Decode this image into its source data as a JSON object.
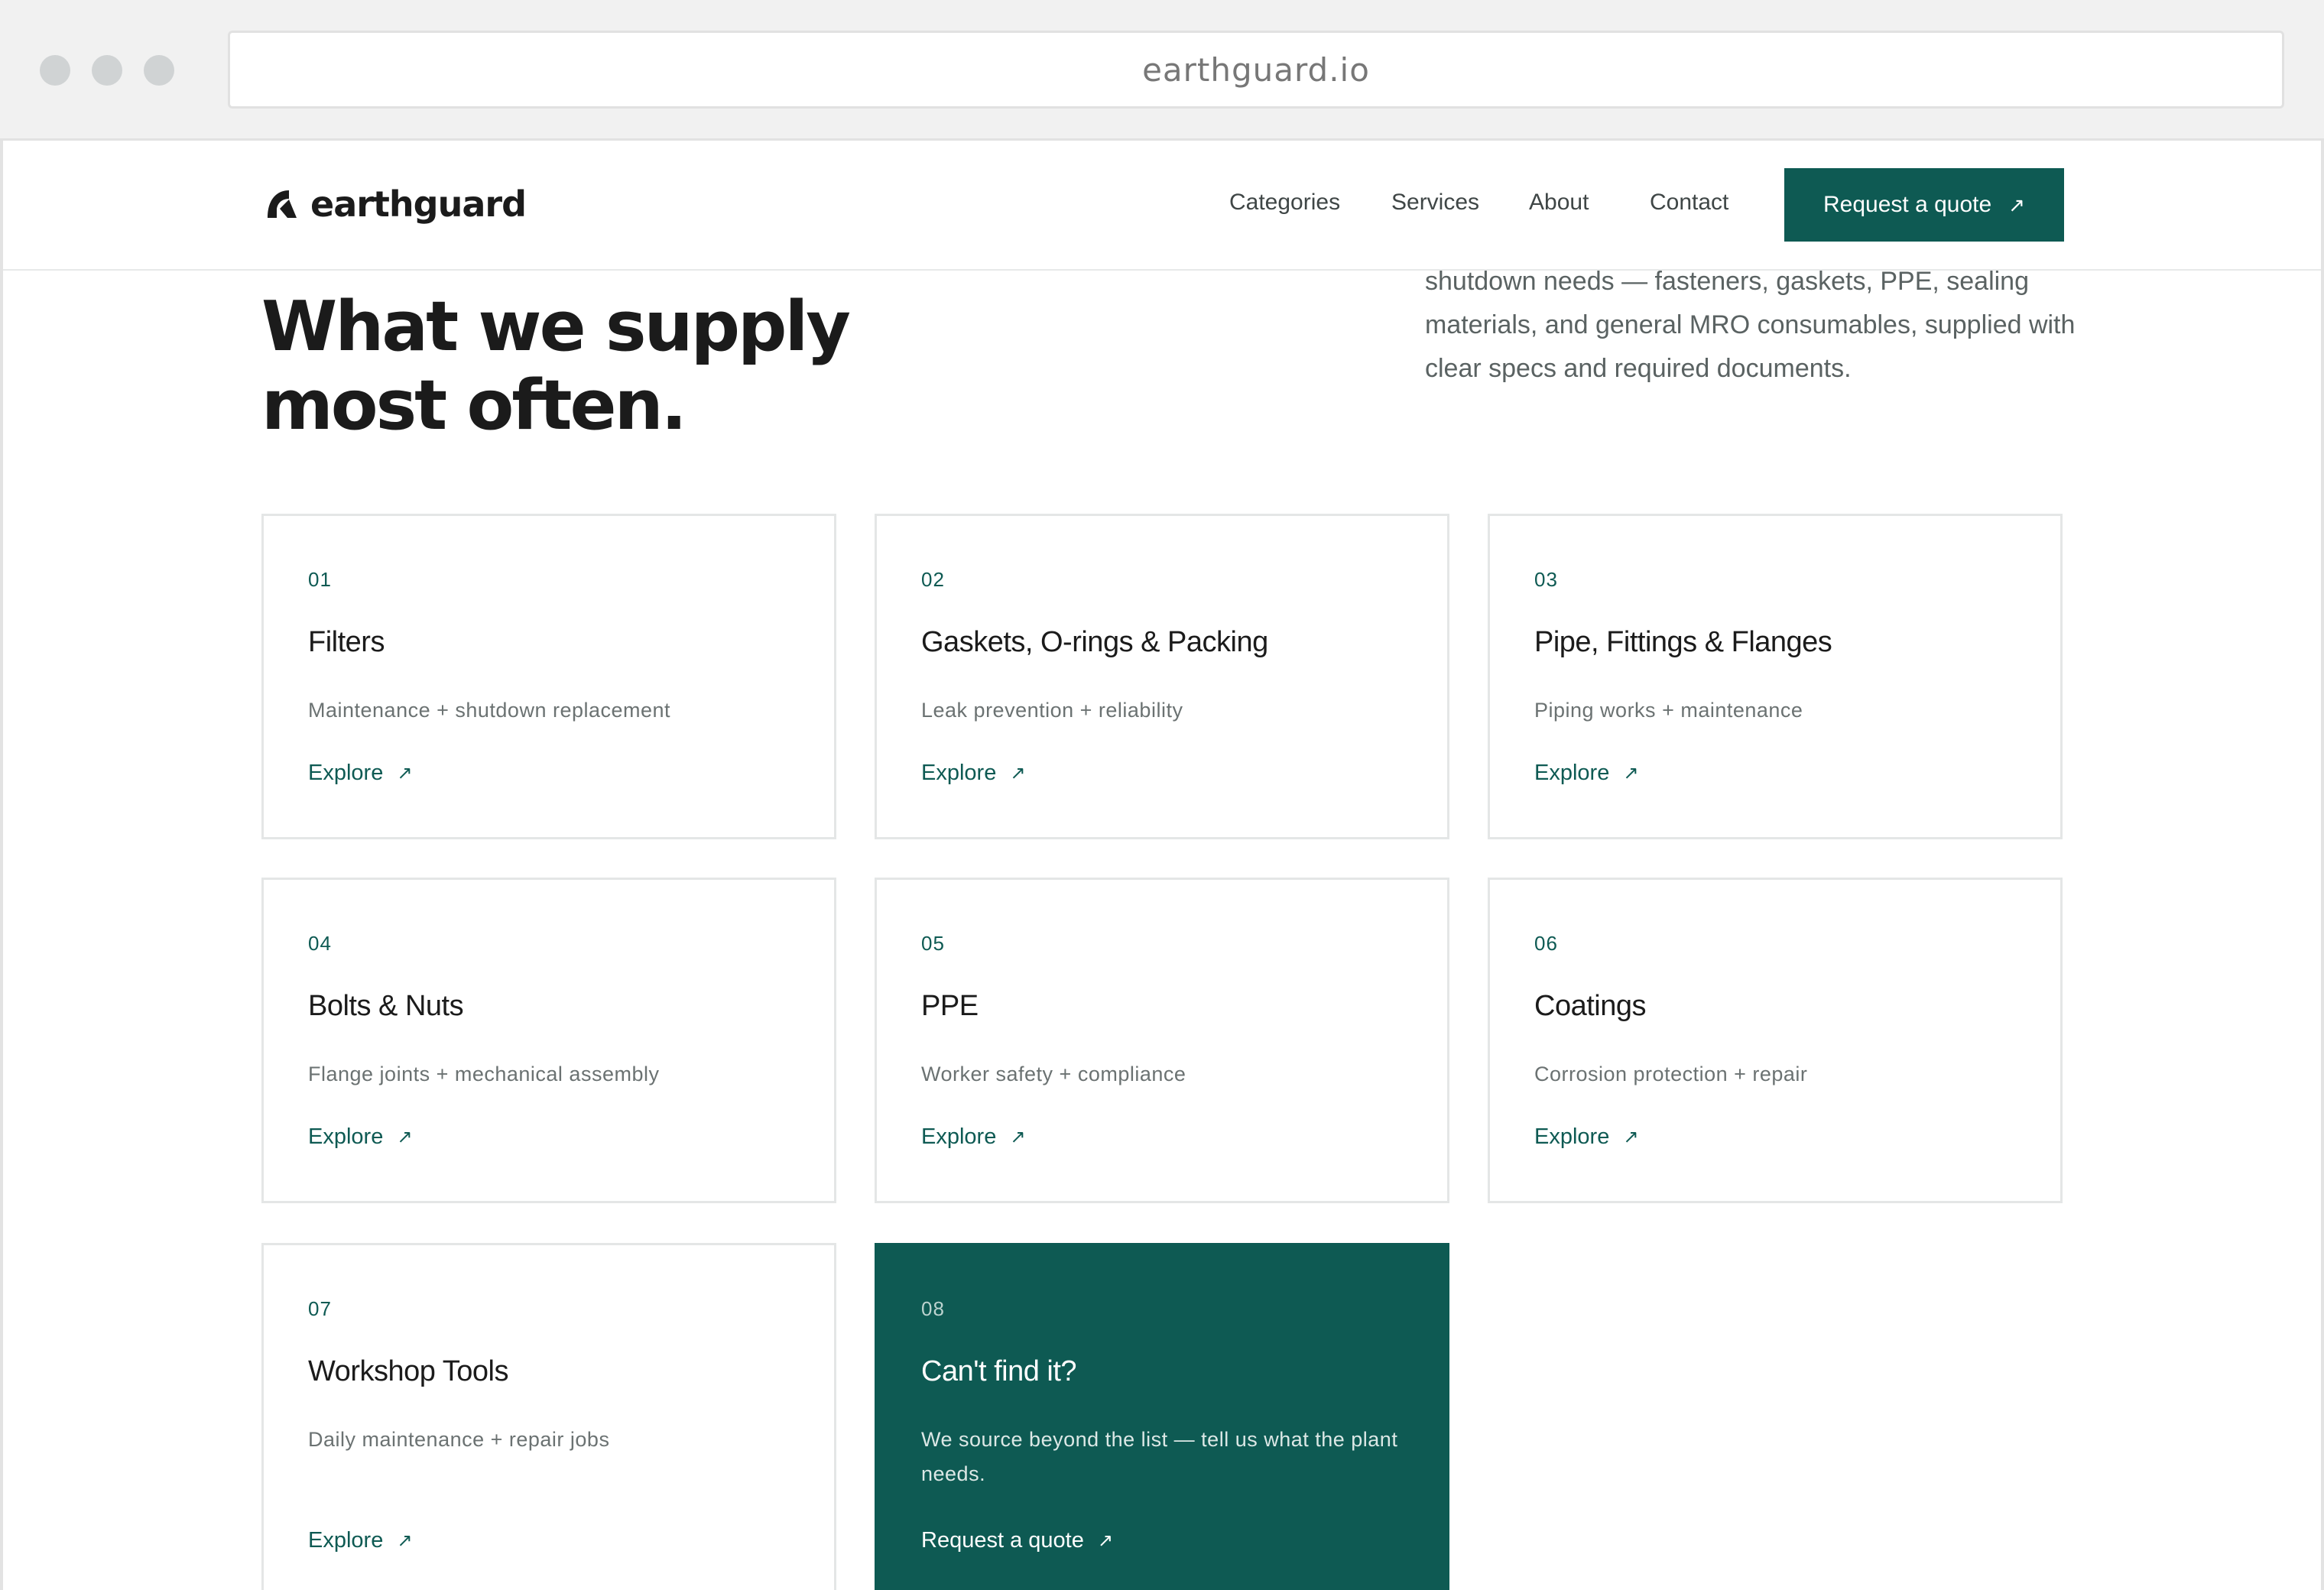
{
  "browser": {
    "url": "earthguard.io"
  },
  "header": {
    "logo_text": "earthguard",
    "nav": [
      {
        "label": "Categories"
      },
      {
        "label": "Services"
      },
      {
        "label": "About"
      },
      {
        "label": "Contact"
      }
    ],
    "cta_label": "Request a quote",
    "cta_icon": "arrow-up-right-icon"
  },
  "intro": {
    "headline_line1": "What we supply",
    "headline_line2": "most often.",
    "text_line1": "shutdown needs — fasteners, gaskets, PPE, sealing",
    "text_line2": "materials, and general MRO consumables, supplied with",
    "text_line3": "clear specs and required documents."
  },
  "cards": [
    {
      "num": "01",
      "title": "Filters",
      "desc": "Maintenance + shutdown replacement",
      "link": "Explore"
    },
    {
      "num": "02",
      "title": "Gaskets, O-rings & Packing",
      "desc": "Leak prevention + reliability",
      "link": "Explore"
    },
    {
      "num": "03",
      "title": "Pipe, Fittings & Flanges",
      "desc": "Piping works + maintenance",
      "link": "Explore"
    },
    {
      "num": "04",
      "title": "Bolts & Nuts",
      "desc": "Flange joints + mechanical assembly",
      "link": "Explore"
    },
    {
      "num": "05",
      "title": "PPE",
      "desc": "Worker safety + compliance",
      "link": "Explore"
    },
    {
      "num": "06",
      "title": "Coatings",
      "desc": "Corrosion protection + repair",
      "link": "Explore"
    },
    {
      "num": "07",
      "title": "Workshop Tools",
      "desc": "Daily maintenance + repair jobs",
      "link": "Explore"
    },
    {
      "num": "08",
      "title": "Can't find it?",
      "desc": "We source beyond the list — tell us what the plant needs.",
      "link": "Request a quote"
    }
  ],
  "colors": {
    "brand": "#0e5a53",
    "text": "#1b1b1b",
    "muted": "#6b7272",
    "border": "#e4e6e6"
  }
}
